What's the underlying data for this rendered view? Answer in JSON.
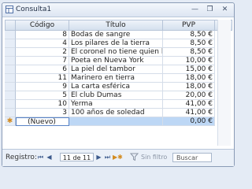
{
  "window": {
    "title": "Consulta1"
  },
  "grid": {
    "columns": [
      "Código",
      "Título",
      "PVP"
    ],
    "rows": [
      {
        "codigo": "8",
        "titulo": "Bodas de sangre",
        "pvp": "8,50 €"
      },
      {
        "codigo": "4",
        "titulo": "Los pilares de la tierra",
        "pvp": "8,50 €"
      },
      {
        "codigo": "2",
        "titulo": "El coronel no tiene quien le…",
        "pvp": "8,50 €"
      },
      {
        "codigo": "7",
        "titulo": "Poeta en Nueva York",
        "pvp": "10,00 €"
      },
      {
        "codigo": "6",
        "titulo": "La piel del tambor",
        "pvp": "15,00 €"
      },
      {
        "codigo": "11",
        "titulo": "Marinero en tierra",
        "pvp": "18,00 €"
      },
      {
        "codigo": "9",
        "titulo": "La carta esférica",
        "pvp": "18,00 €"
      },
      {
        "codigo": "5",
        "titulo": "El club Dumas",
        "pvp": "20,00 €"
      },
      {
        "codigo": "10",
        "titulo": "Yerma",
        "pvp": "41,00 €"
      },
      {
        "codigo": "3",
        "titulo": "100 años de soledad",
        "pvp": "41,00 €"
      }
    ],
    "new_row": {
      "marker": "✱",
      "codigo": "(Nuevo)",
      "titulo": "",
      "pvp": "0,00 €"
    }
  },
  "navigation": {
    "label": "Registro:",
    "position": "11 de 11",
    "filter_label": "Sin filtro",
    "search_placeholder": "Buscar"
  },
  "colors": {
    "selection": "#bdd7f5",
    "header": "#d5e0ee",
    "accent": "#3c5a8c"
  }
}
